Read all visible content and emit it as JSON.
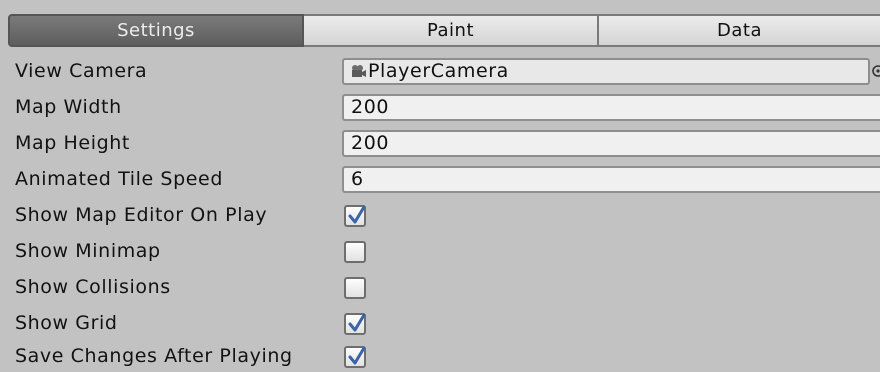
{
  "tabs": [
    {
      "label": "Settings",
      "active": true
    },
    {
      "label": "Paint",
      "active": false
    },
    {
      "label": "Data",
      "active": false
    }
  ],
  "fields": {
    "view_camera": {
      "label": "View Camera",
      "value": "PlayerCamera",
      "icon": "camera-icon"
    },
    "map_width": {
      "label": "Map Width",
      "value": "200"
    },
    "map_height": {
      "label": "Map Height",
      "value": "200"
    },
    "animated_tile_speed": {
      "label": "Animated Tile Speed",
      "value": "6"
    }
  },
  "toggles": {
    "show_map_editor_on_play": {
      "label": "Show Map Editor On Play",
      "checked": true
    },
    "show_minimap": {
      "label": "Show Minimap",
      "checked": false
    },
    "show_collisions": {
      "label": "Show Collisions",
      "checked": false
    },
    "show_grid": {
      "label": "Show Grid",
      "checked": true
    },
    "save_changes_after_playing": {
      "label": "Save Changes After Playing",
      "checked": true
    }
  },
  "colors": {
    "background": "#c2c2c2",
    "active_tab": "#6a6a6a",
    "check_mark": "#3a63a8"
  }
}
